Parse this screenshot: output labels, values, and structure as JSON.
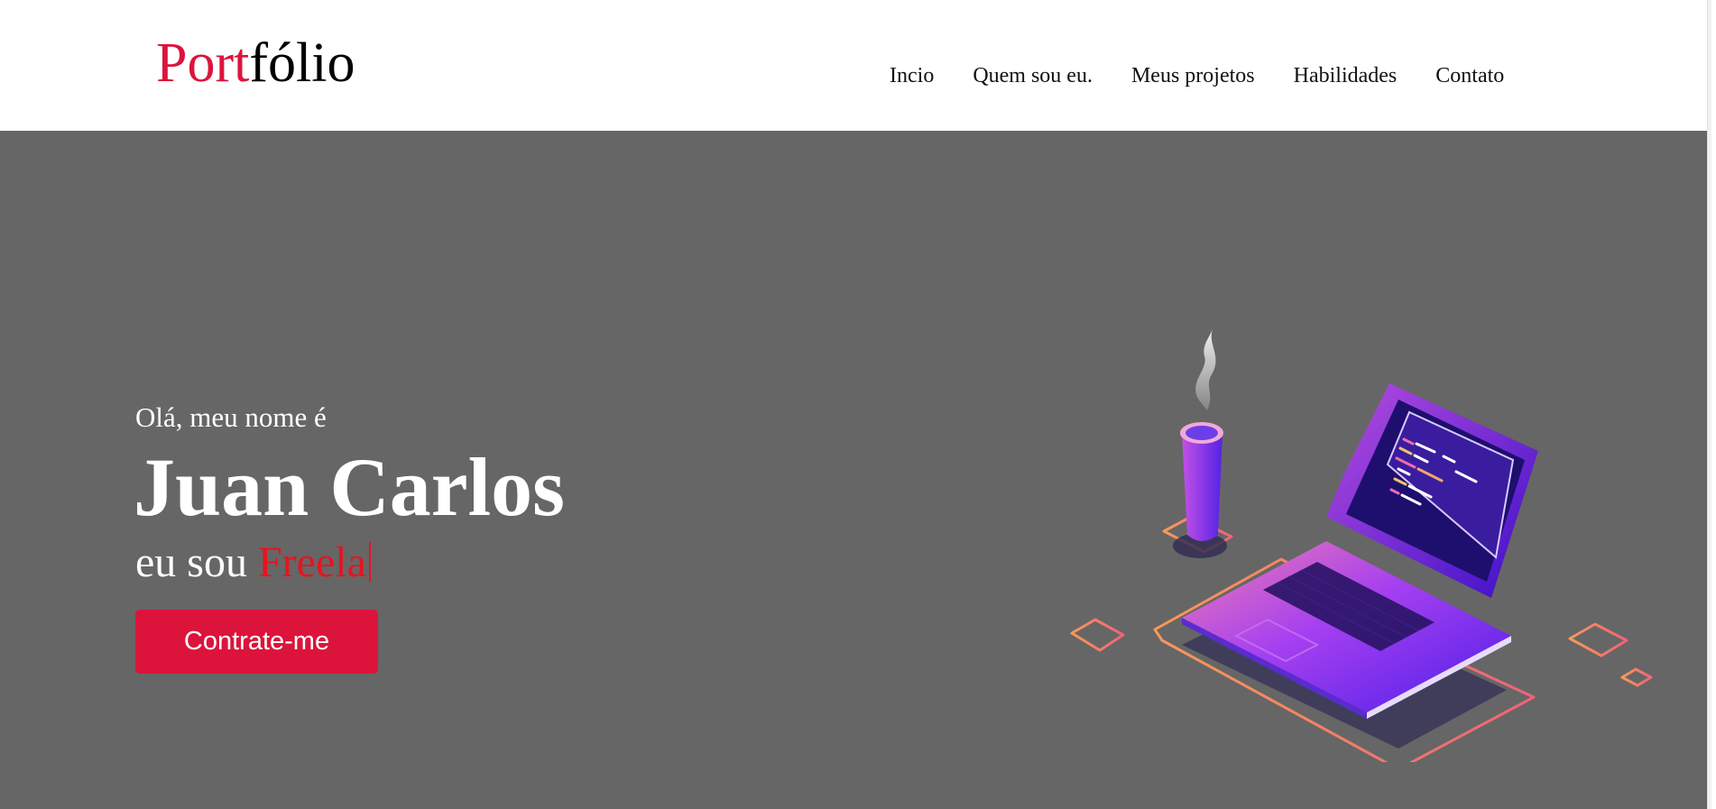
{
  "header": {
    "logo_accent": "Port",
    "logo_rest": "fólio",
    "nav": [
      {
        "label": "Incio"
      },
      {
        "label": "Quem sou eu."
      },
      {
        "label": "Meus projetos"
      },
      {
        "label": "Habilidades"
      },
      {
        "label": "Contato"
      }
    ]
  },
  "hero": {
    "greeting": "Olá, meu nome é",
    "name": "Juan Carlos",
    "role_prefix": "eu sou",
    "role_highlight": "Freela",
    "cta_label": "Contrate-me",
    "illustration_icon": "laptop-coffee-illustration"
  },
  "colors": {
    "accent": "#dc143c",
    "hero_background": "#666666",
    "typed_text": "#e8131f"
  }
}
